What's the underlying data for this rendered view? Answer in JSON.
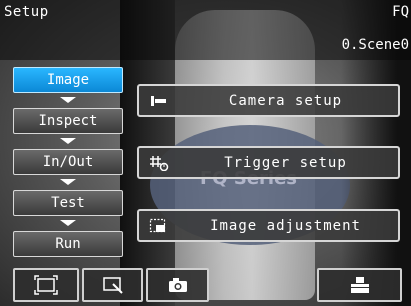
{
  "header": {
    "title": "Setup",
    "model": "FQ",
    "scene": "0.Scene0"
  },
  "nav": {
    "items": [
      {
        "label": "Image",
        "active": true
      },
      {
        "label": "Inspect",
        "active": false
      },
      {
        "label": "In/Out",
        "active": false
      },
      {
        "label": "Test",
        "active": false
      },
      {
        "label": "Run",
        "active": false
      }
    ]
  },
  "menu": {
    "camera_setup": {
      "label": "Camera setup",
      "icon": "camera-setup-icon"
    },
    "trigger_setup": {
      "label": "Trigger setup",
      "icon": "trigger-setup-icon"
    },
    "image_adjustment": {
      "label": "Image adjustment",
      "icon": "image-adjustment-icon"
    }
  },
  "camera_image": {
    "sensor_text": "FQ Series"
  },
  "toolbar": {
    "items": [
      "fit-to-screen-icon",
      "zoom-icon",
      "camera-icon",
      "save-settings-icon"
    ]
  },
  "colors": {
    "active_tab": "#1a9fe8",
    "button_border": "#d6d6d6",
    "button_bg": "#3a3a3a"
  }
}
